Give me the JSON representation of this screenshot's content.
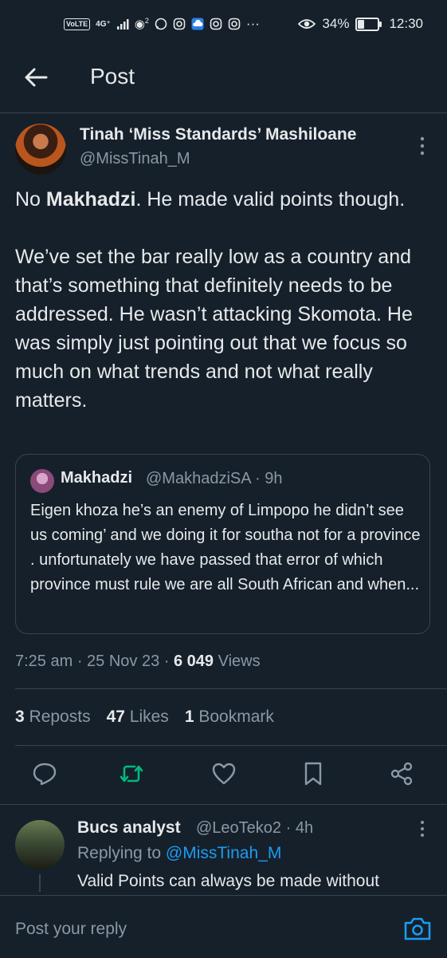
{
  "status_bar": {
    "volte": "VoLTE",
    "network": "4G⁺",
    "hotspot_sup": "2",
    "battery_percent": "34%",
    "battery_level": 0.34,
    "time": "12:30",
    "dots": "···"
  },
  "header": {
    "title": "Post"
  },
  "tweet": {
    "author_name": "Tinah ‘Miss Standards’ Mashiloane",
    "author_handle": "@MissTinah_M",
    "text_part1": "No ",
    "text_bold": "Makhadzi",
    "text_part2": ". He made valid points though.\n\nWe’ve set the bar really low as a country and that’s something that definitely needs to be addressed. He wasn’t attacking Skomota. He was simply just pointing out that we focus so much on what trends and not what really matters.",
    "time": "7:25 am",
    "date": "25 Nov 23",
    "views_count": "6 049",
    "views_label": "Views",
    "reposts_count": "3",
    "reposts_label": "Reposts",
    "likes_count": "47",
    "likes_label": "Likes",
    "bookmarks_count": "1",
    "bookmarks_label": "Bookmark"
  },
  "quote": {
    "name": "Makhadzi",
    "handle_time": "@MakhadziSA · 9h",
    "text": "Eigen khoza he’s an enemy of Limpopo he didn’t see us coming’ and we doing it for southa not for a province . unfortunately we have passed that error of which province must rule we are all South African and when..."
  },
  "reply": {
    "name": "Bucs analyst",
    "handle_time": "@LeoTeko2 · 4h",
    "replying_prefix": "Replying to ",
    "replying_handle": "@MissTinah_M",
    "text": "Valid Points can always be made without"
  },
  "composer": {
    "placeholder": "Post your reply"
  },
  "colors": {
    "background": "#15202b",
    "accent": "#1d9bf0",
    "repost_green": "#00ba7c",
    "muted": "#8b98a5",
    "border": "#38444d"
  }
}
